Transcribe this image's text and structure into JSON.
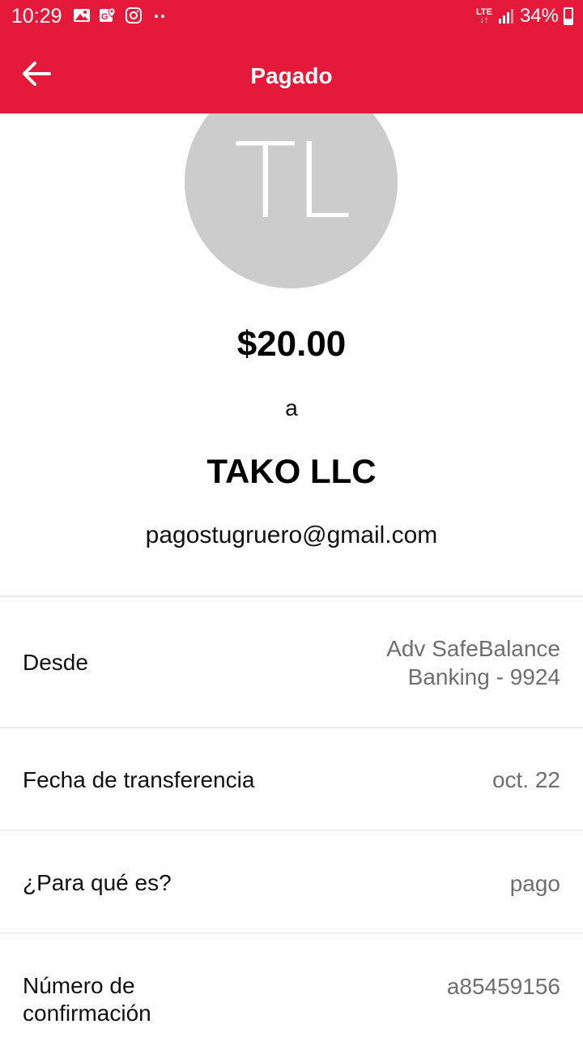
{
  "status_bar": {
    "time": "10:29",
    "network": "LTE",
    "battery": "34%"
  },
  "header": {
    "title": "Pagado",
    "back_icon": "arrow-left-icon",
    "color": "#e5193a"
  },
  "payment": {
    "avatar_initials": "TL",
    "amount": "$20.00",
    "to_word": "a",
    "recipient": "TAKO LLC",
    "email": "pagostugruero@gmail.com"
  },
  "details": [
    {
      "label": "Desde",
      "value_line1": "Adv SafeBalance",
      "value_line2": "Banking - 9924"
    },
    {
      "label": "Fecha de transferencia",
      "value": "oct. 22"
    },
    {
      "label": "¿Para qué es?",
      "value": "pago"
    },
    {
      "label_line1": "Número de",
      "label_line2": "confirmación",
      "value": "a85459156"
    }
  ]
}
